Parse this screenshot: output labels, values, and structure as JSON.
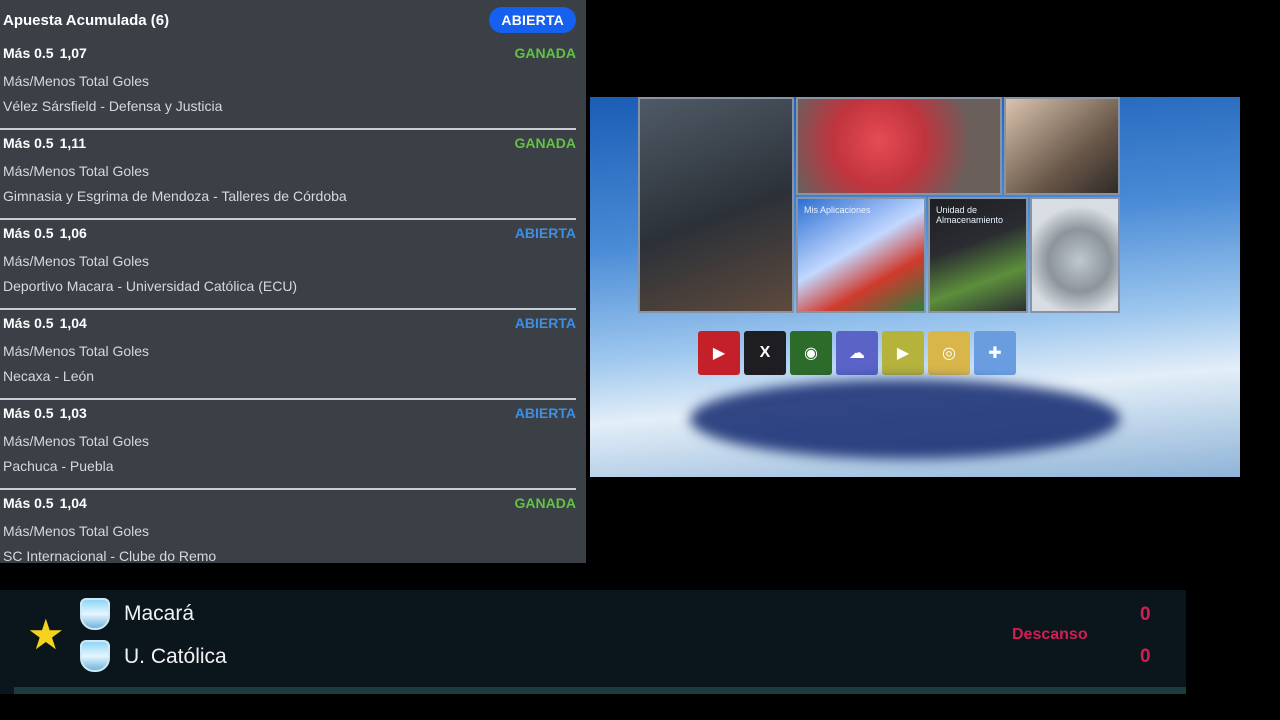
{
  "slip": {
    "title": "Apuesta Acumulada (6)",
    "status": "ABIERTA",
    "bets": [
      {
        "selection": "Más 0.5",
        "odds": "1,07",
        "status": "GANADA",
        "market": "Más/Menos Total Goles",
        "match": "Vélez Sársfield - Defensa y Justicia"
      },
      {
        "selection": "Más 0.5",
        "odds": "1,11",
        "status": "GANADA",
        "market": "Más/Menos Total Goles",
        "match": "Gimnasia y Esgrima de Mendoza - Talleres de Córdoba"
      },
      {
        "selection": "Más 0.5",
        "odds": "1,06",
        "status": "ABIERTA",
        "market": "Más/Menos Total Goles",
        "match": "Deportivo Macara - Universidad Católica (ECU)"
      },
      {
        "selection": "Más 0.5",
        "odds": "1,04",
        "status": "ABIERTA",
        "market": "Más/Menos Total Goles",
        "match": "Necaxa - León"
      },
      {
        "selection": "Más 0.5",
        "odds": "1,03",
        "status": "ABIERTA",
        "market": "Más/Menos Total Goles",
        "match": "Pachuca - Puebla"
      },
      {
        "selection": "Más 0.5",
        "odds": "1,04",
        "status": "GANADA",
        "market": "Más/Menos Total Goles",
        "match": "SC Internacional - Clube do Remo"
      }
    ]
  },
  "video": {
    "tile_labels": [
      "Mis Aplicaciones",
      "Unidad de Almacenamiento"
    ],
    "apps": [
      {
        "icon": "youtube-icon",
        "glyph": "▶",
        "color": "#c4202a"
      },
      {
        "icon": "xtream-icon",
        "glyph": "X",
        "color": "#1e1e22"
      },
      {
        "icon": "iptv-icon",
        "glyph": "◉",
        "color": "#2d6b2a"
      },
      {
        "icon": "cloud-icon",
        "glyph": "☁",
        "color": "#5b63c6"
      },
      {
        "icon": "play-store-icon",
        "glyph": "▶",
        "color": "#b5b33c"
      },
      {
        "icon": "chrome-icon",
        "glyph": "◎",
        "color": "#d8b64a"
      },
      {
        "icon": "add-icon",
        "glyph": "✚",
        "color": "#6a9de0"
      }
    ]
  },
  "scoreboard": {
    "home_team": "Macará",
    "away_team": "U. Católica",
    "period": "Descanso",
    "home_score": "0",
    "away_score": "0",
    "colors": {
      "score": "#d11e55",
      "star": "#f4d21e"
    }
  }
}
